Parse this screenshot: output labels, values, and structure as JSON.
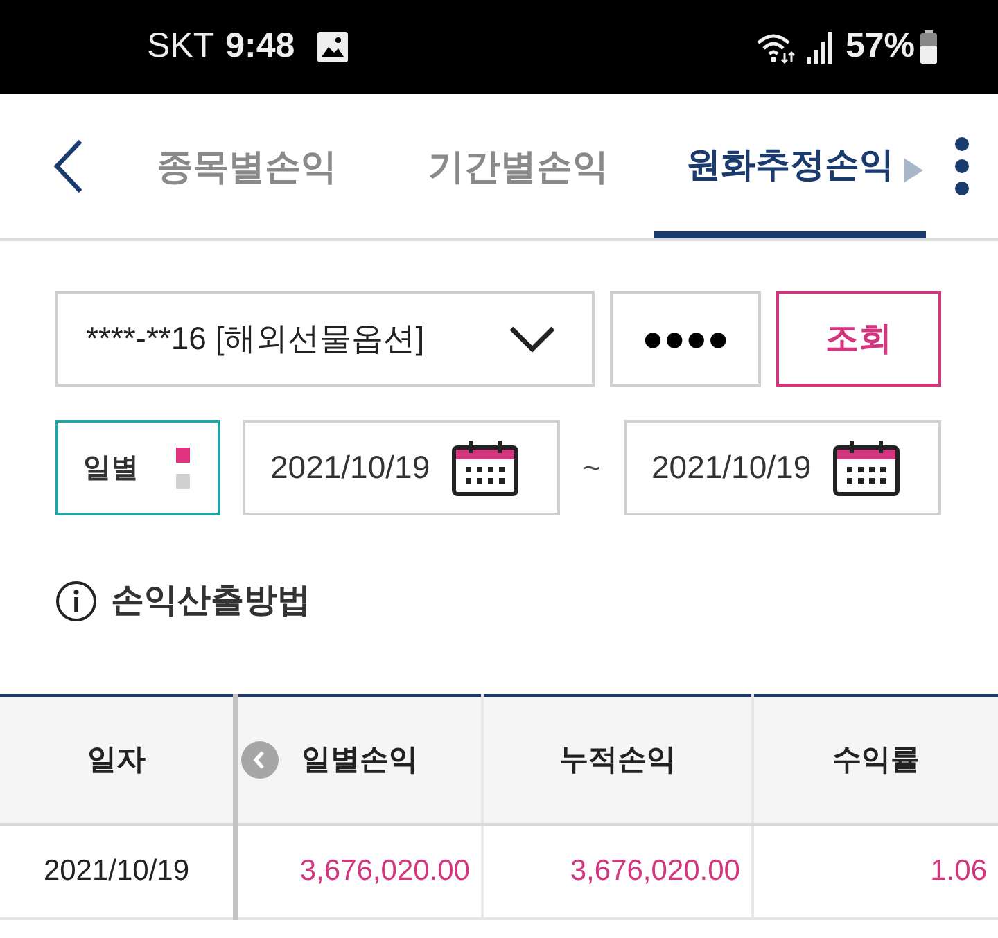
{
  "status_bar": {
    "carrier": "SKT",
    "time": "9:48",
    "battery": "57%"
  },
  "tabs": [
    {
      "label": "종목별손익",
      "selected": false
    },
    {
      "label": "기간별손익",
      "selected": false
    },
    {
      "label": "원화추정손익",
      "selected": true
    }
  ],
  "query": {
    "account": "****-**16 [해외선물옵션]",
    "password": "●●●●",
    "search_button": "조회"
  },
  "period": {
    "label": "일별",
    "dots": [
      {
        "selected": true
      },
      {
        "selected": false
      }
    ]
  },
  "dates": {
    "from": "2021/10/19",
    "separator": "~",
    "to": "2021/10/19"
  },
  "info_link": "손익산출방법",
  "table": {
    "columns": [
      "일자",
      "일별손익",
      "누적손익",
      "수익률"
    ],
    "rows": [
      [
        "2021/10/19",
        "3,676,020.00",
        "3,676,020.00",
        "1.06"
      ]
    ]
  }
}
